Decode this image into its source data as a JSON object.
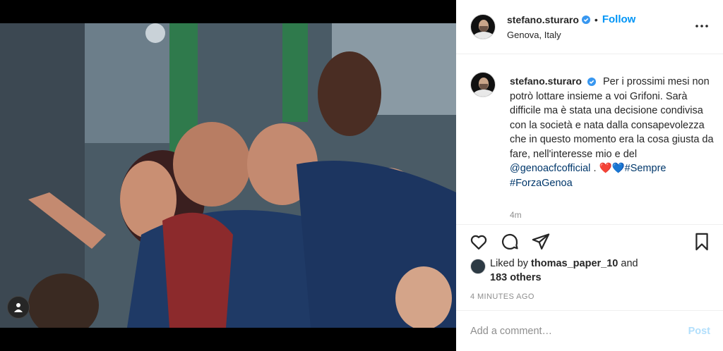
{
  "post": {
    "username": "stefano.sturaro",
    "follow_label": "Follow",
    "separator": "•",
    "location": "Genova, Italy",
    "caption_text": "Per i prossimi mesi non potrò lottare insieme a voi Grifoni. Sarà difficile ma è stata una decisione condivisa con la società e nata dalla consapevolezza che in questo momento era la cosa giusta da fare, nell'interesse mio e del",
    "caption_mention": "@genoacfcofficial",
    "caption_after_mention": " . ",
    "caption_hearts": "❤️💙",
    "caption_tags": [
      "#Sempre",
      "#ForzaGenoa"
    ],
    "time_short": "4m",
    "liked_by_prefix": "Liked by",
    "liked_by_user": "thomas_paper_10",
    "liked_by_and": "and",
    "liked_by_others": "183 others",
    "posted_time": "4 MINUTES AGO",
    "comment_placeholder": "Add a comment…",
    "post_label": "Post"
  },
  "icons": {
    "more": "more-options-icon",
    "like": "heart-icon",
    "comment": "comment-icon",
    "share": "share-icon",
    "save": "bookmark-icon",
    "verified": "verified-badge-icon",
    "user_tags": "user-tag-icon"
  },
  "colors": {
    "accent": "#0095f6",
    "verified": "#3897f0",
    "link": "#00376b",
    "muted": "#8e8e8e",
    "post_disabled": "#b2dffc"
  }
}
